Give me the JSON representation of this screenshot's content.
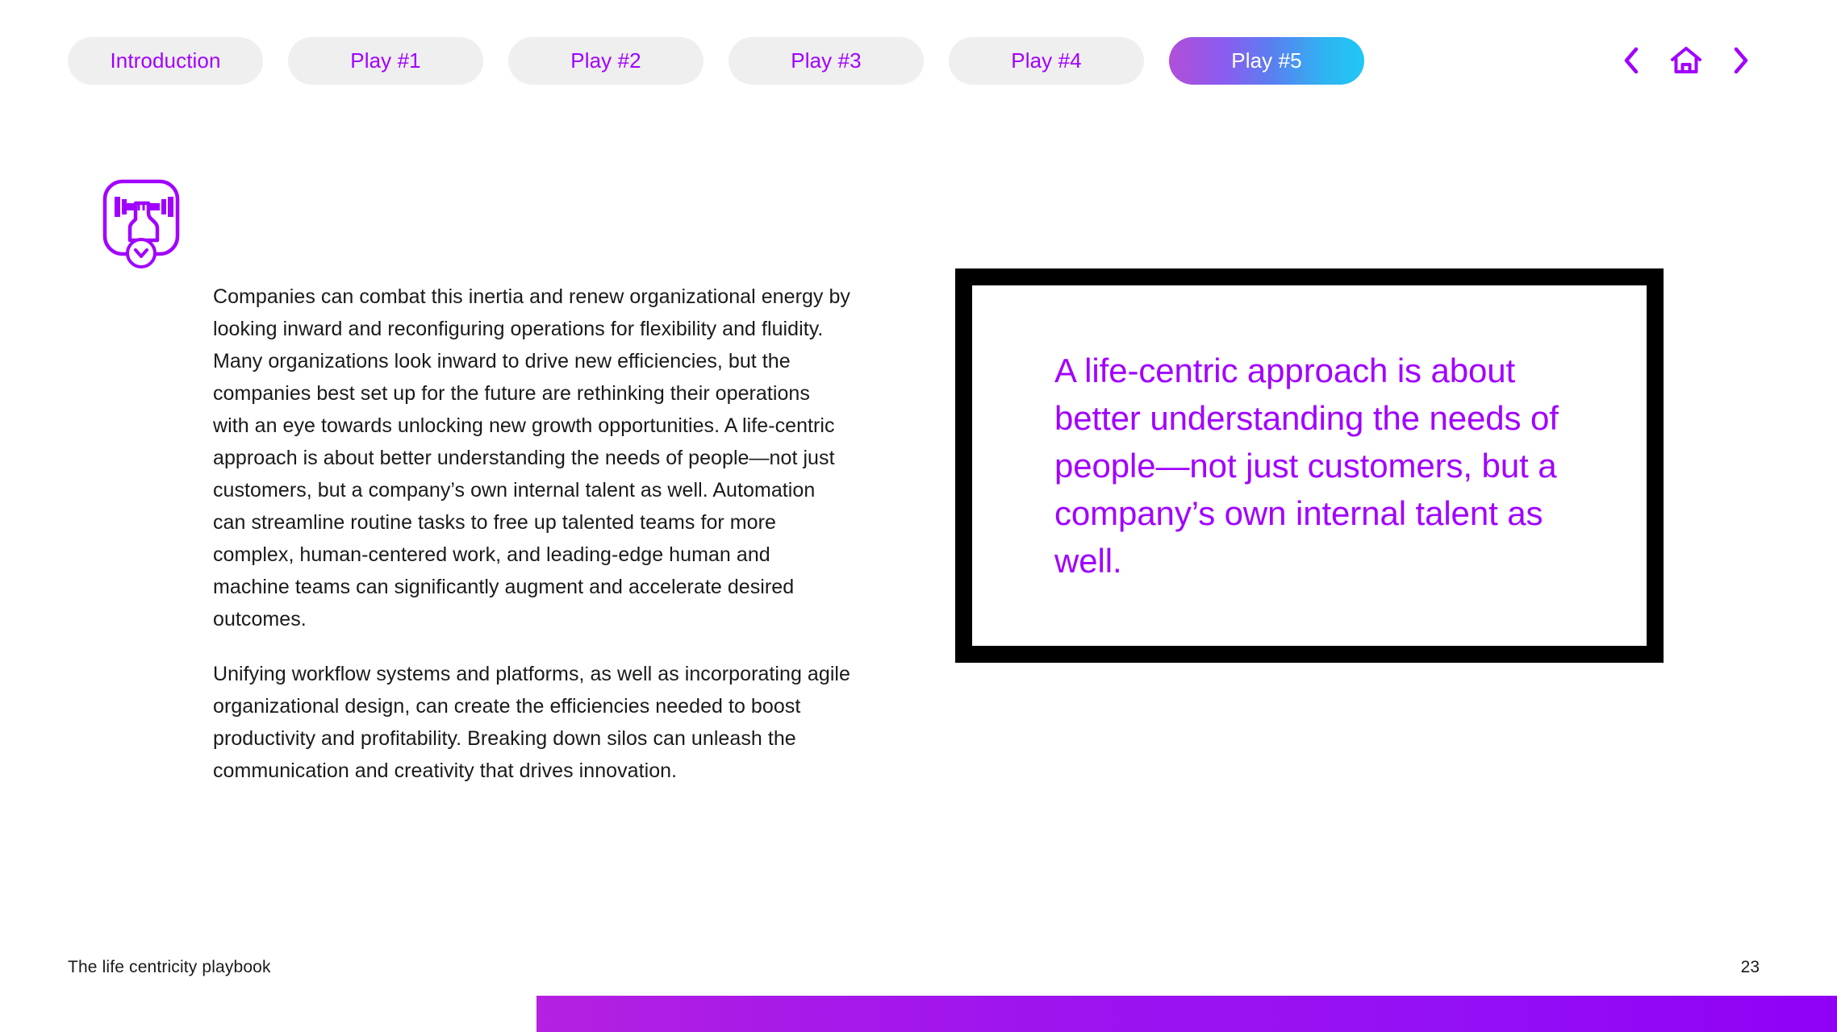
{
  "tabs": [
    {
      "label": "Introduction",
      "active": false
    },
    {
      "label": "Play #1",
      "active": false
    },
    {
      "label": "Play #2",
      "active": false
    },
    {
      "label": "Play #3",
      "active": false
    },
    {
      "label": "Play #4",
      "active": false
    },
    {
      "label": "Play #5",
      "active": true
    }
  ],
  "topnav": {
    "previous_label": "Previous page",
    "home_label": "Home",
    "next_label": "Next page"
  },
  "play_icon": {
    "name": "dumbbell-strength-icon",
    "badge": "chevron-down-icon"
  },
  "body": {
    "paragraphs": [
      "Companies can combat this inertia and renew organizational energy by looking inward and reconfiguring operations for flexibility and fluidity. Many organizations look inward to drive new efficiencies, but the companies best set up for the future are rethinking their operations with an eye towards unlocking new growth opportunities. A life-centric approach is about better understanding the needs of people—not just customers, but a company’s own internal talent as well. Automation can streamline routine tasks to free up talented teams for more complex, human-centered work, and leading-edge human and machine teams can significantly augment and accelerate desired outcomes.",
      "Unifying workflow systems and platforms, as well as incorporating agile organizational design, can create the efficiencies needed to boost productivity and profitability. Breaking down silos can unleash the communication and creativity that drives innovation."
    ]
  },
  "pull_quote": {
    "text": "A life-centric approach is about better understanding the needs of people—not just customers, but a company’s own internal talent as well."
  },
  "footer": {
    "title": "The life centricity playbook",
    "page_number": "23"
  },
  "colors": {
    "accent_purple": "#a100ff",
    "tab_inactive_bg": "#f0efef",
    "active_tab_gradient_start": "#b14fd8",
    "active_tab_gradient_end": "#1ec8f5",
    "quote_border": "#000000",
    "bottom_bar_gradient_start": "#b521e0",
    "bottom_bar_gradient_end": "#9000f7",
    "body_text": "#1a1a1a"
  }
}
